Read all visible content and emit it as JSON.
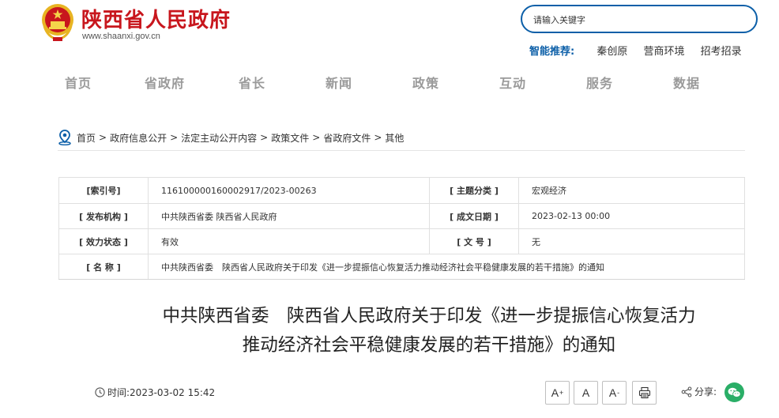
{
  "header": {
    "site_title": "陕西省人民政府",
    "site_url": "www.shaanxi.gov.cn",
    "search_placeholder": "请输入关键字",
    "smart_rec_label": "智能推荐:",
    "smart_rec_links": [
      "秦创原",
      "营商环境",
      "招考招录"
    ]
  },
  "nav": {
    "items": [
      "首页",
      "省政府",
      "省长",
      "新闻",
      "政策",
      "互动",
      "服务",
      "数据"
    ]
  },
  "breadcrumb": {
    "items": [
      "首页",
      "政府信息公开",
      "法定主动公开内容",
      "政策文件",
      "省政府文件",
      "其他"
    ],
    "separator": ">"
  },
  "info": {
    "index_label": "[索引号]",
    "index_value": "116100000160002917/2023-00263",
    "topic_label": "[ 主题分类 ]",
    "topic_value": "宏观经济",
    "issuer_label": "[ 发布机构 ]",
    "issuer_value": "中共陕西省委 陕西省人民政府",
    "date_label": "[ 成文日期 ]",
    "date_value": "2023-02-13 00:00",
    "status_label": "[ 效力状态 ]",
    "status_value": "有效",
    "docno_label": "[ 文 号 ]",
    "docno_value": "无",
    "name_label": "[ 名 称 ]",
    "name_value": "中共陕西省委　陕西省人民政府关于印发《进一步提振信心恢复活力推动经济社会平稳健康发展的若干措施》的通知"
  },
  "article": {
    "title_line1": "中共陕西省委　陕西省人民政府关于印发《进一步提振信心恢复活力",
    "title_line2": "推动经济社会平稳健康发展的若干措施》的通知",
    "time_label": "时间:",
    "time_value": "2023-03-02 15:42",
    "font_larger": "A",
    "font_larger_mark": "+",
    "font_normal": "A",
    "font_smaller": "A",
    "font_smaller_mark": "-",
    "share_label": "分享:"
  },
  "colors": {
    "brand_red": "#c8161d",
    "accent_blue": "#0c5fa8",
    "nav_gray": "#9a9a9a",
    "wechat_green": "#2aae67"
  }
}
